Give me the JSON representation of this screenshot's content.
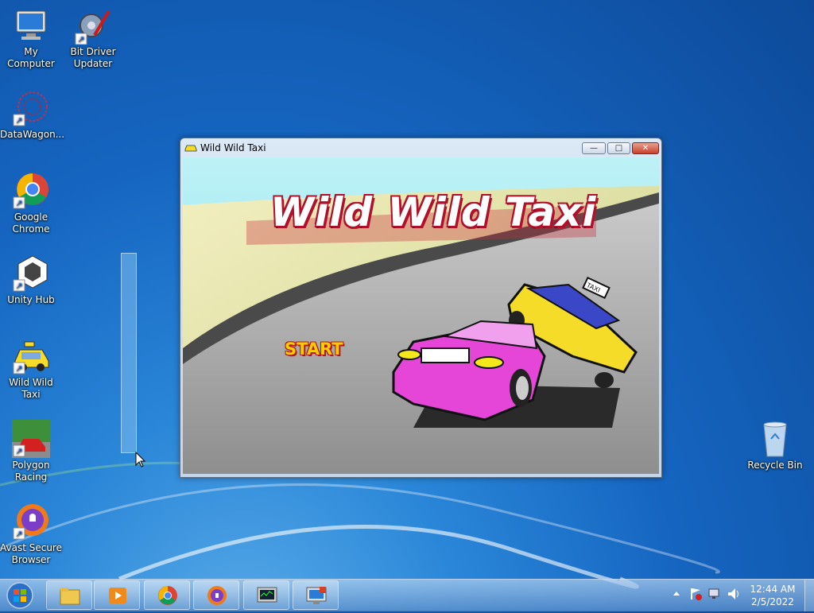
{
  "desktop": {
    "icons": [
      {
        "label": "My Computer",
        "icon": "computer-icon"
      },
      {
        "label": "Bit Driver Updater",
        "icon": "gear-icon"
      },
      {
        "label": "DataWagon...",
        "icon": "datawagon-icon"
      },
      {
        "label": "Google Chrome",
        "icon": "chrome-icon"
      },
      {
        "label": "Unity Hub",
        "icon": "unity-icon"
      },
      {
        "label": "Wild Wild Taxi",
        "icon": "taxi-icon"
      },
      {
        "label": "Polygon Racing",
        "icon": "racing-icon"
      },
      {
        "label": "Avast Secure Browser",
        "icon": "avast-icon"
      },
      {
        "label": "Recycle Bin",
        "icon": "recycle-bin-icon"
      }
    ]
  },
  "window": {
    "title": "Wild Wild Taxi",
    "buttons": {
      "minimize": "—",
      "maximize": "□",
      "close": "✕"
    }
  },
  "game": {
    "title": "Wild Wild Taxi",
    "start_label": "START",
    "taxi_sign": "TAXI",
    "colors": {
      "sky": "#8fe0ec",
      "sand": "#e6e1a0",
      "road": "#a3a3a3",
      "taxi": "#f5dc28",
      "car": "#e646d8"
    }
  },
  "taskbar": {
    "items": [
      "file-explorer-icon",
      "media-player-icon",
      "chrome-icon",
      "avast-icon",
      "task-manager-icon",
      "remote-desktop-icon"
    ],
    "clock": {
      "time": "12:44 AM",
      "date": "2/5/2022"
    }
  }
}
